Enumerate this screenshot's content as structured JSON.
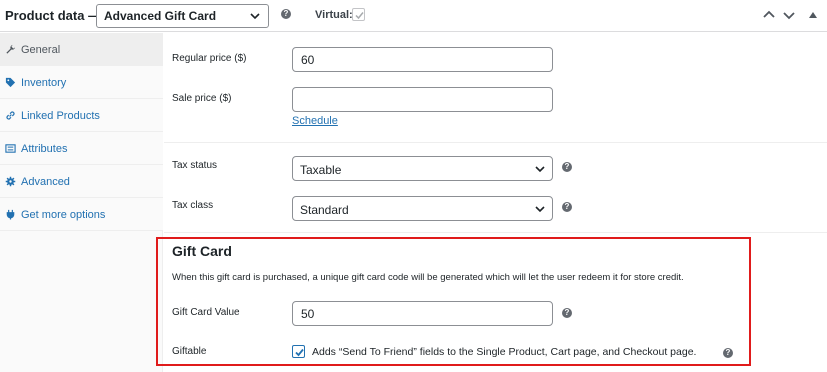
{
  "header": {
    "title": "Product data —",
    "product_type": "Advanced Gift Card",
    "help_glyph": "?",
    "virtual_label": "Virtual:",
    "virtual_checked": true
  },
  "sidebar": {
    "items": [
      {
        "label": "General",
        "icon": "wrench-icon",
        "active": true
      },
      {
        "label": "Inventory",
        "icon": "tag-icon",
        "active": false
      },
      {
        "label": "Linked Products",
        "icon": "link-icon",
        "active": false
      },
      {
        "label": "Attributes",
        "icon": "list-icon",
        "active": false
      },
      {
        "label": "Advanced",
        "icon": "gear-icon",
        "active": false
      },
      {
        "label": "Get more options",
        "icon": "plugin-icon",
        "active": false
      }
    ]
  },
  "pricing": {
    "regular_price_label": "Regular price ($)",
    "regular_price_value": "60",
    "sale_price_label": "Sale price ($)",
    "sale_price_value": "",
    "schedule_link": "Schedule"
  },
  "tax": {
    "status_label": "Tax status",
    "status_value": "Taxable",
    "class_label": "Tax class",
    "class_value": "Standard"
  },
  "gift_card": {
    "title": "Gift Card",
    "description": "When this gift card is purchased, a unique gift card code will be generated which will let the user redeem it for store credit.",
    "value_label": "Gift Card Value",
    "value": "50",
    "giftable_label": "Giftable",
    "giftable_checked": true,
    "giftable_text": "Adds “Send To Friend” fields to the Single Product, Cart page, and Checkout page."
  },
  "colors": {
    "link": "#2271b1",
    "highlight_border": "#e01b1b",
    "help_icon": "#646970"
  }
}
